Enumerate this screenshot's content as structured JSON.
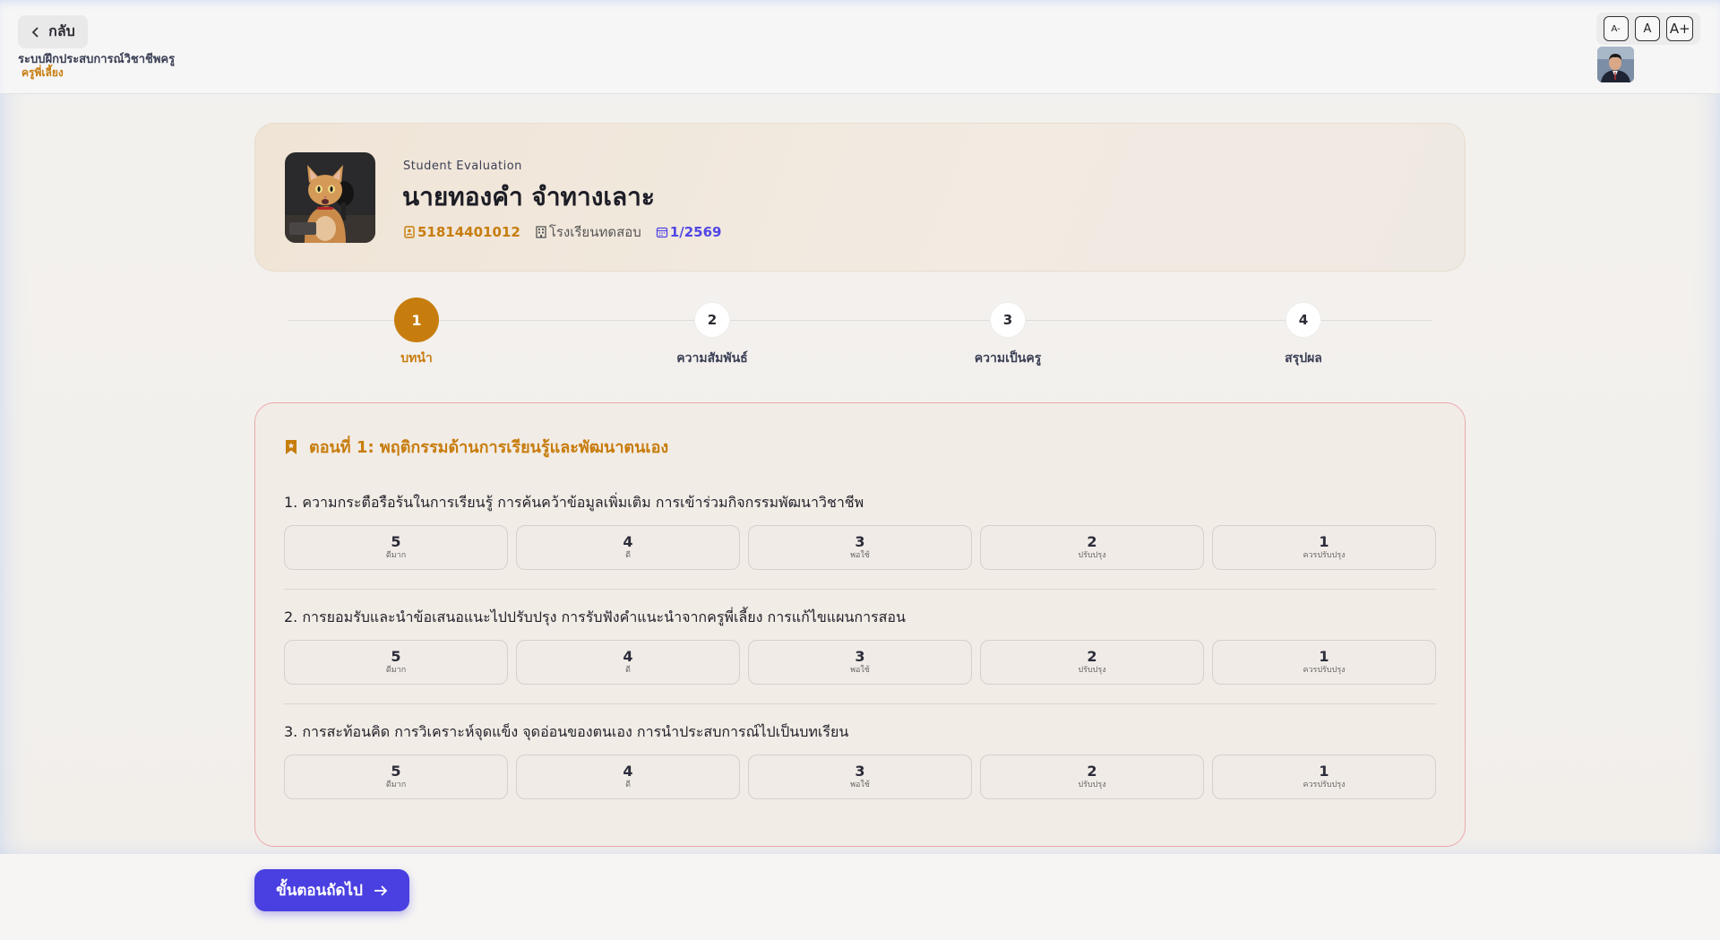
{
  "header": {
    "back_label": "กลับ",
    "app_title": "ระบบฝึกประสบการณ์วิชาชีพครู",
    "role": "ครูพี่เลี้ยง",
    "font_small": "A-",
    "font_normal": "A",
    "font_large": "A+"
  },
  "profile": {
    "eval_label": "Student Evaluation",
    "name": "นายทองคำ จำทางเลาะ",
    "student_id": "51814401012",
    "school": "โรงเรียนทดสอบ",
    "term": "1/2569"
  },
  "steps": [
    {
      "number": "1",
      "label": "บทนำ",
      "active": true
    },
    {
      "number": "2",
      "label": "ความสัมพันธ์",
      "active": false
    },
    {
      "number": "3",
      "label": "ความเป็นครู",
      "active": false
    },
    {
      "number": "4",
      "label": "สรุปผล",
      "active": false
    }
  ],
  "section": {
    "title": "ตอนที่ 1: พฤติกรรมด้านการเรียนรู้และพัฒนาตนเอง",
    "questions": [
      {
        "text": "1. ความกระตือรือร้นในการเรียนรู้ การค้นคว้าข้อมูลเพิ่มเติม การเข้าร่วมกิจกรรมพัฒนาวิชาชีพ"
      },
      {
        "text": "2. การยอมรับและนำข้อเสนอแนะไปปรับปรุง การรับฟังคำแนะนำจากครูพี่เลี้ยง การแก้ไขแผนการสอน"
      },
      {
        "text": "3. การสะท้อนคิด การวิเคราะห์จุดแข็ง จุดอ่อนของตนเอง การนำประสบการณ์ไปเป็นบทเรียน"
      }
    ],
    "options": [
      {
        "score": "5",
        "desc": "ดีมาก"
      },
      {
        "score": "4",
        "desc": "ดี"
      },
      {
        "score": "3",
        "desc": "พอใช้"
      },
      {
        "score": "2",
        "desc": "ปรับปรุง"
      },
      {
        "score": "1",
        "desc": "ควรปรับปรุง"
      }
    ]
  },
  "footer": {
    "next_label": "ขั้นตอนถัดไป"
  },
  "icons": {
    "back": "chevron-left-icon",
    "id": "id-card-icon",
    "school": "building-icon",
    "term": "calendar-icon",
    "section": "bookmark-icon",
    "next": "arrow-right-icon"
  },
  "colors": {
    "accent": "#c77d0e",
    "primary": "#4a3fe0",
    "section_border": "#eba8ad"
  }
}
